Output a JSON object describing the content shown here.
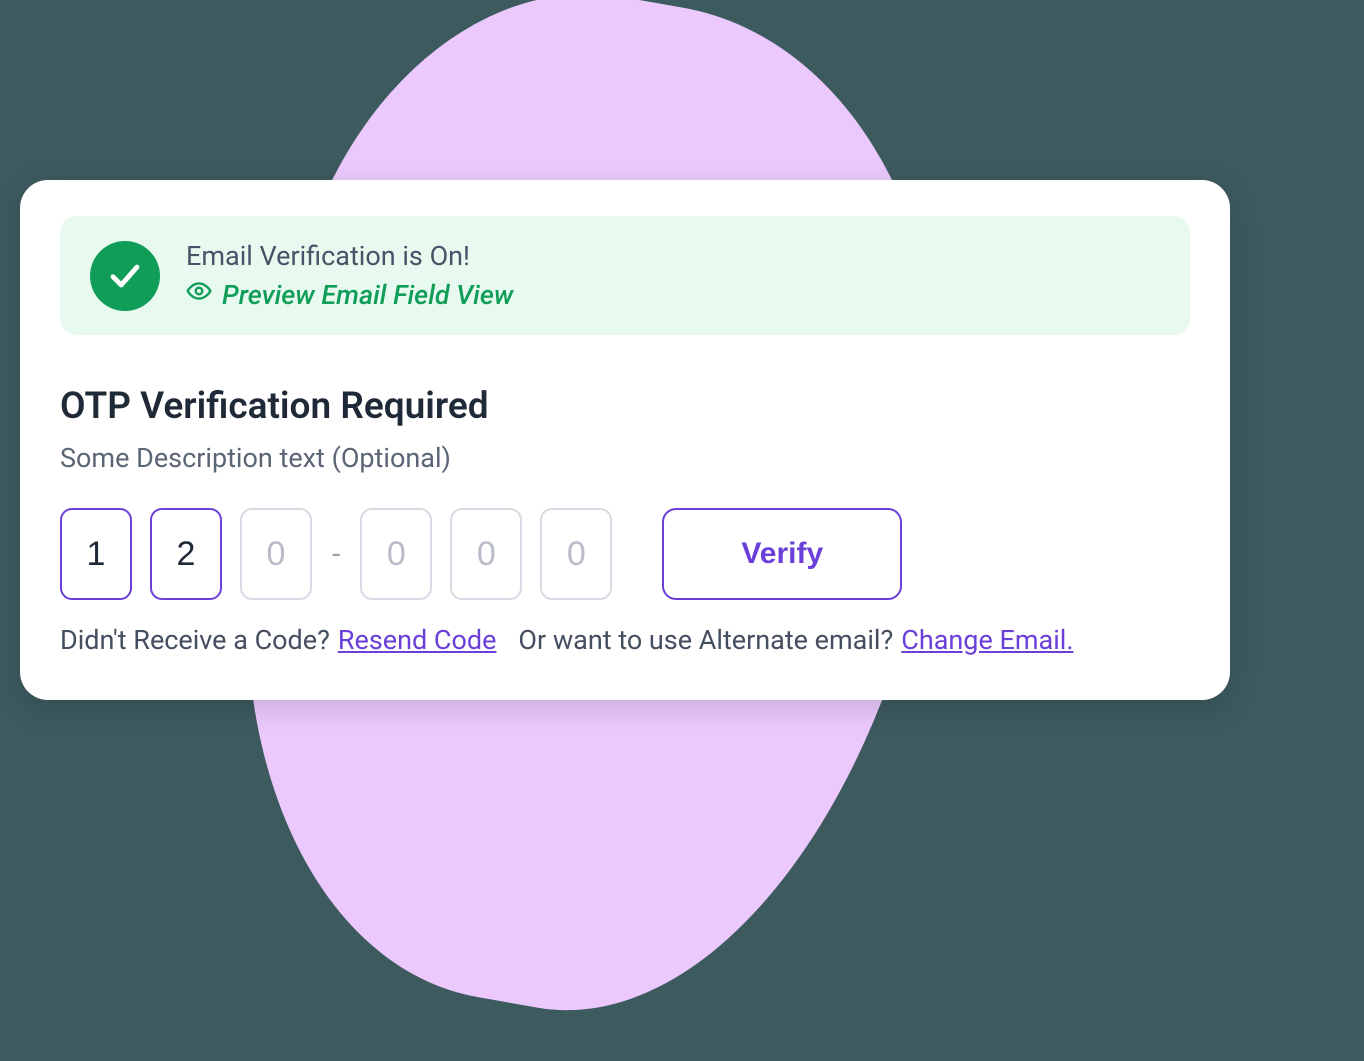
{
  "banner": {
    "title": "Email Verification is On!",
    "preview_link": "Preview Email Field View"
  },
  "section": {
    "title": "OTP Verification Required",
    "description": "Some Description text (Optional)"
  },
  "otp": {
    "values": [
      "1",
      "2",
      "",
      "",
      "",
      ""
    ],
    "placeholder": "0",
    "dash": "-"
  },
  "verify_label": "Verify",
  "helper": {
    "didnt_receive": "Didn't Receive a Code?",
    "resend_link": "Resend Code ",
    "alternate": "Or want to use Alternate email?",
    "change_link": "Change Email."
  },
  "colors": {
    "background": "#3d5a5f",
    "blob": "#ebc9fd",
    "success": "#0f9d58",
    "accent": "#6b3fd9"
  }
}
